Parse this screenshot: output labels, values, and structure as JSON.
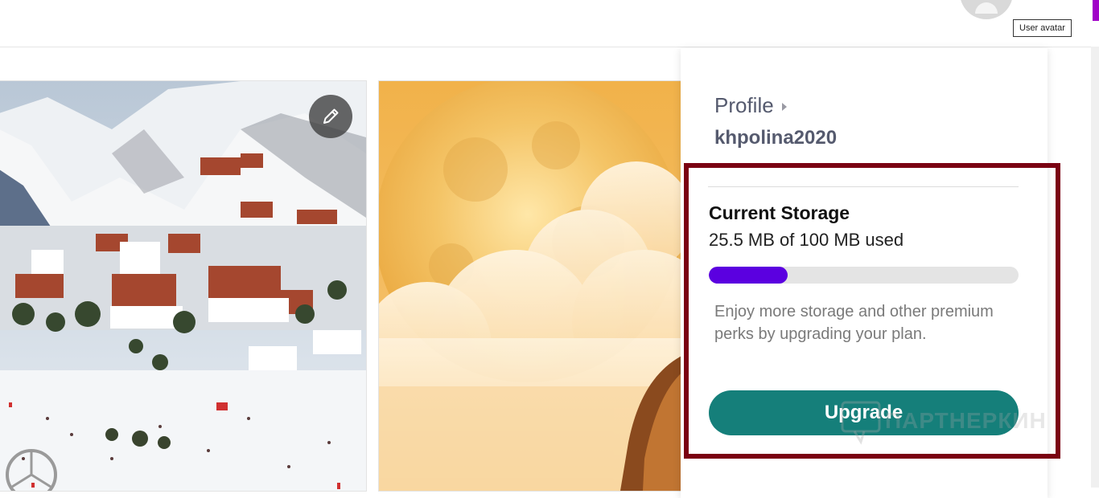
{
  "header": {
    "avatar_tooltip": "User avatar"
  },
  "gallery": {
    "cards": [
      {
        "image": "snowy-mountain-village-photo",
        "edit_icon": "pencil-icon"
      },
      {
        "image": "golden-moon-clouds-photo"
      }
    ]
  },
  "profile_menu": {
    "profile_label": "Profile",
    "username": "khpolina2020",
    "storage": {
      "title": "Current Storage",
      "used_text": "25.5 MB of 100 MB used",
      "used_mb": 25.5,
      "total_mb": 100,
      "bar_color": "#5b00e0"
    },
    "promo_text": "Enjoy more storage and other premium perks by upgrading your plan.",
    "upgrade_label": "Upgrade",
    "upgrade_color": "#157f7a"
  },
  "colors": {
    "highlight_border": "#7a0012",
    "accent_purple": "#a000c8"
  },
  "watermark": "ПАРТНЕРКИН"
}
